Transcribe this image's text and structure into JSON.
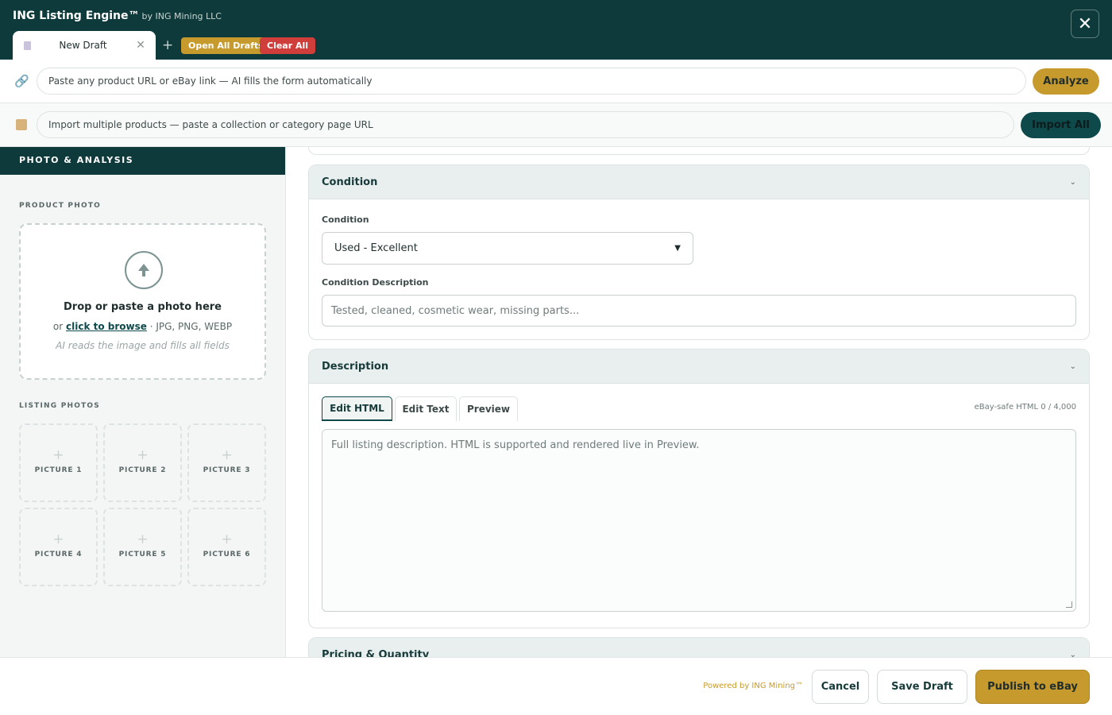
{
  "app": {
    "title": "ING Listing Engine™",
    "subtitle": "by ING Mining LLC",
    "close_icon": "close-icon"
  },
  "tabs": {
    "active_label": "New Draft",
    "open_all_label": "Open All Drafts",
    "clear_all_label": "Clear All",
    "add_symbol": "+",
    "close_symbol": "✕"
  },
  "url_bar": {
    "placeholder": "Paste any product URL or eBay link — AI fills the form automatically",
    "button": "Analyze",
    "icon": "link-icon"
  },
  "import_bar": {
    "placeholder": "Import multiple products — paste a collection or category page URL",
    "button": "Import All",
    "icon": "box-icon"
  },
  "left_panel": {
    "header": "PHOTO & ANALYSIS",
    "product_photo_label": "PRODUCT PHOTO",
    "drop_title": "Drop or paste a photo here",
    "drop_or": "or",
    "drop_link": "click to browse",
    "drop_formats": "· JPG, PNG, WEBP",
    "drop_hint": "AI reads the image and fills all fields",
    "listing_photos_label": "LISTING PHOTOS",
    "pictures": [
      "PICTURE 1",
      "PICTURE 2",
      "PICTURE 3",
      "PICTURE 4",
      "PICTURE 5",
      "PICTURE 6"
    ]
  },
  "condition_section": {
    "title": "Condition",
    "condition_label": "Condition",
    "condition_value": "Used - Excellent",
    "description_label": "Condition Description",
    "description_placeholder": "Tested, cleaned, cosmetic wear, missing parts..."
  },
  "description_section": {
    "title": "Description",
    "tabs": [
      "Edit HTML",
      "Edit Text",
      "Preview"
    ],
    "active_tab": "Edit HTML",
    "counter": "eBay-safe HTML  0 / 4,000",
    "placeholder": "Full listing description. HTML is supported and rendered live in Preview."
  },
  "pricing_section": {
    "title": "Pricing & Quantity"
  },
  "footer": {
    "powered": "Powered by ING Mining™",
    "cancel": "Cancel",
    "save": "Save Draft",
    "publish": "Publish to eBay"
  },
  "colors": {
    "header_bg": "#0e3a3b",
    "accent_gold": "#c79a2e",
    "danger_red": "#cf3e3b",
    "teal_button": "#0e4a4c"
  }
}
